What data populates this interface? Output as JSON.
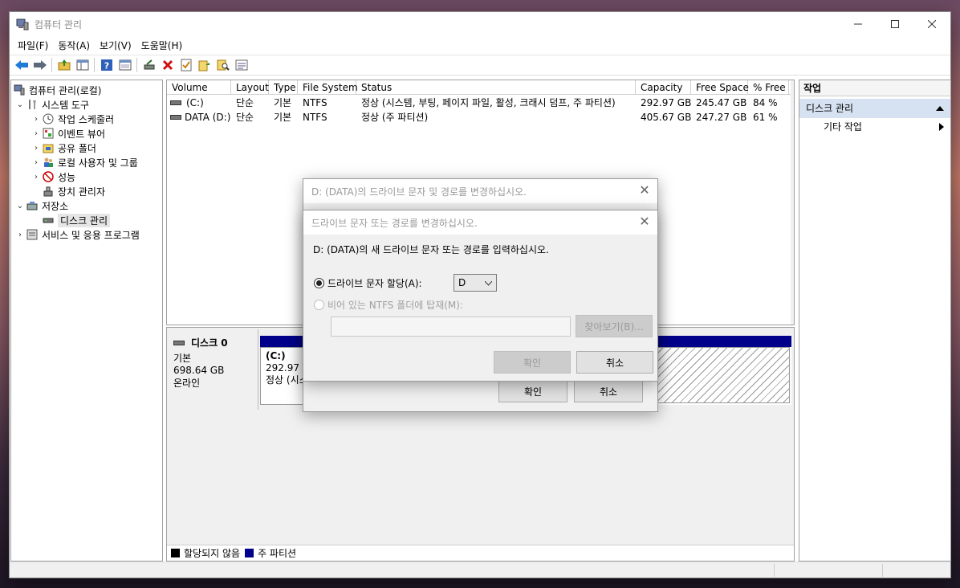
{
  "window": {
    "title": "컴퓨터 관리"
  },
  "menu": [
    "파일(F)",
    "동작(A)",
    "보기(V)",
    "도움말(H)"
  ],
  "tree": {
    "root": "컴퓨터 관리(로컬)",
    "system_tools": "시스템 도구",
    "task_scheduler": "작업 스케줄러",
    "event_viewer": "이벤트 뷰어",
    "shared_folders": "공유 폴더",
    "local_users": "로컬 사용자 및 그룹",
    "performance": "성능",
    "device_manager": "장치 관리자",
    "storage": "저장소",
    "disk_management": "디스크 관리",
    "services": "서비스 및 응용 프로그램"
  },
  "volumes": {
    "headers": [
      "Volume",
      "Layout",
      "Type",
      "File System",
      "Status",
      "Capacity",
      "Free Space",
      "% Free"
    ],
    "rows": [
      {
        "volume": "(C:)",
        "layout": "단순",
        "type": "기본",
        "fs": "NTFS",
        "status": "정상 (시스템, 부팅, 페이지 파일, 활성, 크래시 덤프, 주 파티션)",
        "capacity": "292.97 GB",
        "free": "245.47 GB",
        "pct": "84 %"
      },
      {
        "volume": "DATA (D:)",
        "layout": "단순",
        "type": "기본",
        "fs": "NTFS",
        "status": "정상 (주 파티션)",
        "capacity": "405.67 GB",
        "free": "247.27 GB",
        "pct": "61 %"
      }
    ]
  },
  "disk": {
    "name": "디스크 0",
    "type": "기본",
    "size": "698.64 GB",
    "state": "온라인",
    "partition_c_name": "(C:)",
    "partition_c_size": "292.97 G",
    "partition_c_status": "정상 (시스"
  },
  "legend": {
    "unallocated": "할당되지 않음",
    "primary": "주 파티션"
  },
  "actions": {
    "title": "작업",
    "section": "디스크 관리",
    "more": "기타 작업"
  },
  "dialog_outer": {
    "title": "D: (DATA)의 드라이브 문자 및 경로를 변경하십시오.",
    "ok": "확인",
    "cancel": "취소"
  },
  "dialog_inner": {
    "title": "드라이브 문자 또는 경로를 변경하십시오.",
    "prompt": "D: (DATA)의 새 드라이브 문자 또는 경로를 입력하십시오.",
    "assign_label": "드라이브 문자 할당(A):",
    "letter_value": "D",
    "mount_label": "비어 있는 NTFS 폴더에 탑재(M):",
    "browse": "찾아보기(B)...",
    "ok": "확인",
    "cancel": "취소"
  },
  "colors": {
    "primary_partition": "#00008b",
    "selection": "#d6e2f1"
  }
}
